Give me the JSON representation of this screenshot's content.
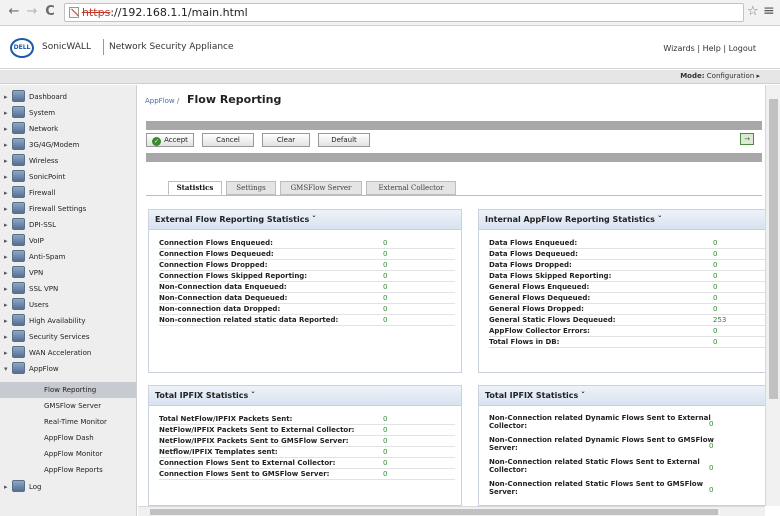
{
  "browser": {
    "back": "←",
    "forward": "→",
    "reload": "C",
    "url_scheme": "https",
    "url_rest": "://192.168.1.1/main.html",
    "star": "☆",
    "menu": "≡"
  },
  "header": {
    "logo": "DELL",
    "brand": "SonicWALL",
    "product": "Network Security Appliance",
    "links": "Wizards | Help | Logout"
  },
  "mode": {
    "label": "Mode:",
    "value": "Configuration ▸"
  },
  "sidebar": {
    "items": [
      {
        "label": "Dashboard",
        "caret": "▸"
      },
      {
        "label": "System",
        "caret": "▸"
      },
      {
        "label": "Network",
        "caret": "▸"
      },
      {
        "label": "3G/4G/Modem",
        "caret": "▸"
      },
      {
        "label": "Wireless",
        "caret": "▸"
      },
      {
        "label": "SonicPoint",
        "caret": "▸"
      },
      {
        "label": "Firewall",
        "caret": "▸"
      },
      {
        "label": "Firewall Settings",
        "caret": "▸"
      },
      {
        "label": "DPI-SSL",
        "caret": "▸"
      },
      {
        "label": "VoIP",
        "caret": "▸"
      },
      {
        "label": "Anti-Spam",
        "caret": "▸"
      },
      {
        "label": "VPN",
        "caret": "▸"
      },
      {
        "label": "SSL VPN",
        "caret": "▸"
      },
      {
        "label": "Users",
        "caret": "▸"
      },
      {
        "label": "High Availability",
        "caret": "▸"
      },
      {
        "label": "Security Services",
        "caret": "▸"
      },
      {
        "label": "WAN Acceleration",
        "caret": "▸"
      },
      {
        "label": "AppFlow",
        "caret": "▾"
      }
    ],
    "subitems": [
      "Flow Reporting",
      "GMSFlow Server",
      "Real-Time Monitor",
      "AppFlow Dash",
      "AppFlow Monitor",
      "AppFlow Reports"
    ],
    "log": {
      "label": "Log",
      "caret": "▸"
    }
  },
  "page": {
    "crumb": "AppFlow /",
    "title": "Flow Reporting"
  },
  "toolbar": {
    "accept": "Accept",
    "cancel": "Cancel",
    "clear": "Clear",
    "default": "Default"
  },
  "tabs": [
    "Statistics",
    "Settings",
    "GMSFlow Server",
    "External Collector"
  ],
  "panels": {
    "external": {
      "title": "External Flow Reporting Statistics ˇ",
      "rows": [
        {
          "label": "Connection Flows Enqueued:",
          "value": "0"
        },
        {
          "label": "Connection Flows Dequeued:",
          "value": "0"
        },
        {
          "label": "Connection Flows Dropped:",
          "value": "0"
        },
        {
          "label": "Connection Flows Skipped Reporting:",
          "value": "0"
        },
        {
          "label": "Non-Connection data Enqueued:",
          "value": "0"
        },
        {
          "label": "Non-Connection data Dequeued:",
          "value": "0"
        },
        {
          "label": "Non-connection data Dropped:",
          "value": "0"
        },
        {
          "label": "Non-connection related static data Reported:",
          "value": "0"
        }
      ]
    },
    "internal": {
      "title": "Internal AppFlow Reporting Statistics ˇ",
      "rows": [
        {
          "label": "Data Flows Enqueued:",
          "value": "0"
        },
        {
          "label": "Data Flows Dequeued:",
          "value": "0"
        },
        {
          "label": "Data Flows Dropped:",
          "value": "0"
        },
        {
          "label": "Data Flows Skipped Reporting:",
          "value": "0"
        },
        {
          "label": "General Flows Enqueued:",
          "value": "0"
        },
        {
          "label": "General Flows Dequeued:",
          "value": "0"
        },
        {
          "label": "General Flows Dropped:",
          "value": "0"
        },
        {
          "label": "General Static Flows Dequeued:",
          "value": "253"
        },
        {
          "label": "AppFlow Collector Errors:",
          "value": "0"
        },
        {
          "label": "Total Flows in DB:",
          "value": "0"
        }
      ]
    },
    "ipfix_left": {
      "title": "Total IPFIX Statistics ˇ",
      "rows": [
        {
          "label": "Total NetFlow/IPFIX Packets Sent:",
          "value": "0"
        },
        {
          "label": "NetFlow/IPFIX Packets Sent to External Collector:",
          "value": "0"
        },
        {
          "label": "NetFlow/IPFIX Packets Sent to GMSFlow Server:",
          "value": "0"
        },
        {
          "label": "Netflow/IPFIX Templates sent:",
          "value": "0"
        },
        {
          "label": "Connection Flows Sent to External Collector:",
          "value": "0"
        },
        {
          "label": "Connection Flows Sent to GMSFlow Server:",
          "value": "0"
        }
      ]
    },
    "ipfix_right": {
      "title": "Total IPFIX Statistics ˇ",
      "rows": [
        {
          "label": "Non-Connection related Dynamic Flows Sent to External Collector:",
          "value": "0"
        },
        {
          "label": "Non-Connection related Dynamic Flows Sent to GMSFlow Server:",
          "value": "0"
        },
        {
          "label": "Non-Connection related Static Flows Sent to External Collector:",
          "value": "0"
        },
        {
          "label": "Non-Connection related Static Flows Sent to GMSFlow Server:",
          "value": "0"
        }
      ]
    }
  }
}
